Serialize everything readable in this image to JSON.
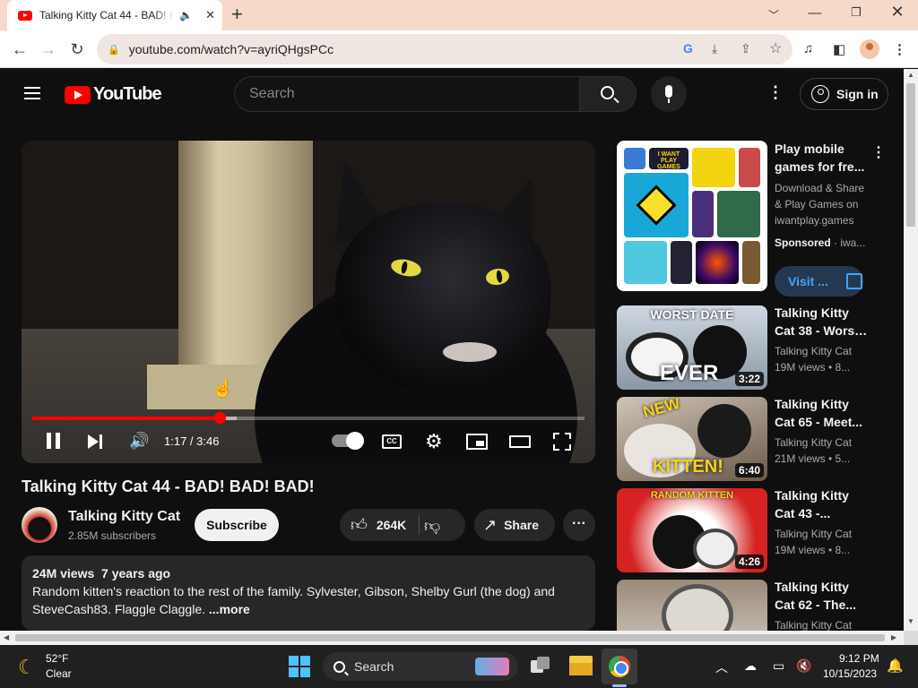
{
  "browser": {
    "tab_title": "Talking Kitty Cat 44 - BAD! BAD! BAD!",
    "url": "youtube.com/watch?v=ayriQHgsPCc"
  },
  "masthead": {
    "logo_text": "YouTube",
    "search_placeholder": "Search",
    "signin_label": "Sign in"
  },
  "player": {
    "time_display": "1:17 / 3:46",
    "progress_played": 0.34,
    "progress_loaded": 0.37,
    "cc_label": "CC"
  },
  "video": {
    "title": "Talking Kitty Cat 44 - BAD! BAD! BAD!",
    "channel_name": "Talking Kitty Cat",
    "subscribers": "2.85M subscribers",
    "subscribe_label": "Subscribe",
    "like_count": "264K",
    "share_label": "Share",
    "stats": "24M views  7 years ago",
    "description": "Random kitten's reaction to the rest of the family. Sylvester, Gibson, Shelby Gurl (the dog) and SteveCash83. Flaggle Claggle.",
    "more_label": "...more"
  },
  "sidebar": {
    "ad": {
      "title": "Play mobile games for fre...",
      "description": "Download & Share & Play Games on iwantplay.games",
      "sponsored_label": "Sponsored",
      "sponsored_domain": " · iwa...",
      "visit_label": "Visit ...",
      "thumb_caption": "I WANT PLAY GAMES"
    },
    "recommendations": [
      {
        "title_line1": "Talking Kitty",
        "title_line2": "Cat 38 - Worst...",
        "channel": "Talking Kitty Cat",
        "meta": "19M views  • 8...",
        "duration": "3:22",
        "caption_top": "WORST DATE",
        "caption_big": "EVER"
      },
      {
        "title_line1": "Talking Kitty",
        "title_line2": "Cat 65 - Meet...",
        "channel": "Talking Kitty Cat",
        "meta": "21M views  • 5...",
        "duration": "6:40",
        "caption_top": "NEW",
        "caption_big": "KITTEN!"
      },
      {
        "title_line1": "Talking Kitty",
        "title_line2": "Cat 43 -...",
        "channel": "Talking Kitty Cat",
        "meta": "19M views  • 8...",
        "duration": "4:26",
        "caption_top": "RANDOM KITTEN",
        "caption_big": ""
      },
      {
        "title_line1": "Talking Kitty",
        "title_line2": "Cat 62 - The...",
        "channel": "Talking Kitty Cat",
        "meta": "",
        "duration": "",
        "caption_top": "",
        "caption_big": ""
      }
    ]
  },
  "taskbar": {
    "weather_temp": "52°F",
    "weather_condition": "Clear",
    "search_label": "Search",
    "clock_time": "9:12 PM",
    "clock_date": "10/15/2023"
  }
}
